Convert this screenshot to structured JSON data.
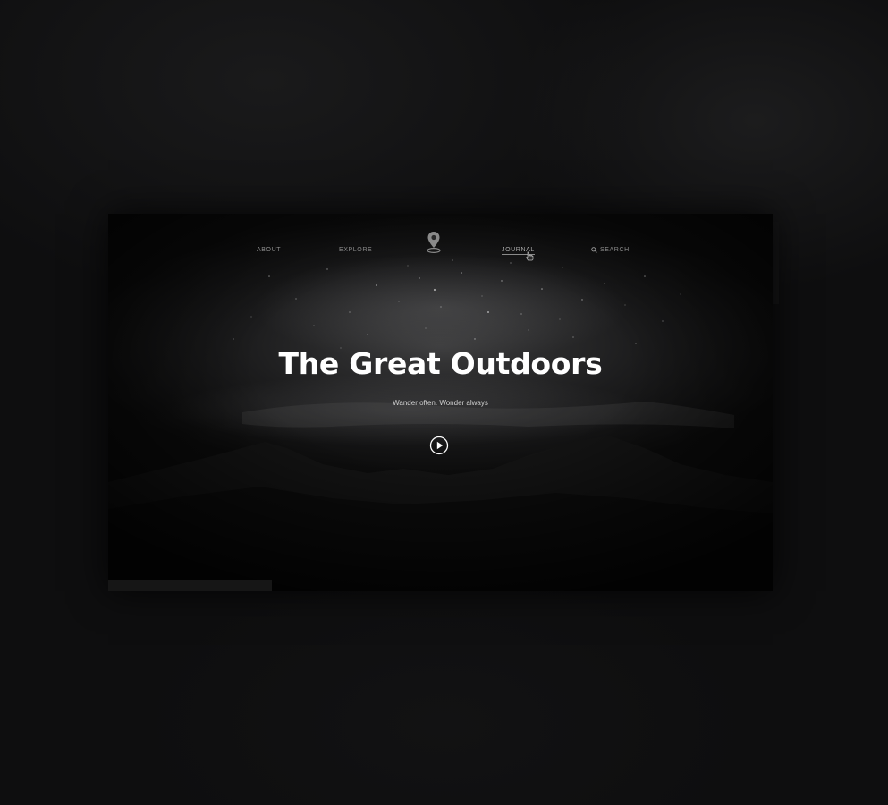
{
  "nav": {
    "items": [
      {
        "label": "ABOUT",
        "active": false
      },
      {
        "label": "EXPLORE",
        "active": false
      },
      {
        "label": "JOURNAL",
        "active": true
      },
      {
        "label": "SEARCH",
        "active": false
      }
    ],
    "logo_icon": "map-pin-icon",
    "search_icon": "search-icon",
    "cursor_icon": "hand-pointer-icon"
  },
  "hero": {
    "title": "The Great Outdoors",
    "subtitle": "Wander often. Wonder always",
    "play_icon": "play-circle-icon"
  },
  "colors": {
    "background": "#0e0e0f",
    "hero_text": "#ffffff",
    "nav_text": "#8c8c8c"
  }
}
